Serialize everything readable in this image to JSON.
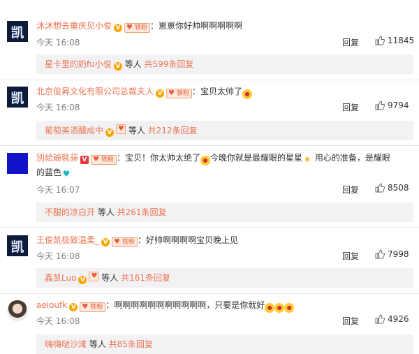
{
  "comments": [
    {
      "username": "沐沐想去重庆见小俊",
      "fan_badge": "铁粉",
      "text": "：崽崽你好帅啊啊啊啊啊",
      "time": "今天 16:08",
      "reply_label": "回复",
      "likes": "11845",
      "replies": {
        "users": "星卡里的奶fu小俊",
        "mid": " 等人 ",
        "count": "共599条回复"
      }
    },
    {
      "username": "北京俊昇文化有限公司总裁夫人",
      "fan_badge": "铁粉",
      "text": "：宝贝太帅了",
      "time": "今天 16:08",
      "reply_label": "回复",
      "likes": "9794",
      "replies": {
        "users": "葡萄美酒醺成中",
        "mid": " 等人 ",
        "count": "共212条回复"
      }
    },
    {
      "username": "別給爺裝蒜",
      "fan_badge": "铁粉",
      "text_a": "：宝贝！你太帅太绝了",
      "text_b": "今晚你就是最耀眼的星星",
      "text_c": " 用心的准备，是耀眼",
      "text_d": "的蓝色",
      "time": "今天 16:07",
      "reply_label": "回复",
      "likes": "8508",
      "replies": {
        "users": "不甜的凉白开",
        "mid": " 等人 ",
        "count": "共261条回复"
      }
    },
    {
      "username": "王俊凯极致温柔_",
      "fan_badge": "铁粉",
      "text": "：好帅啊啊啊啊宝贝晚上见",
      "time": "今天 16:08",
      "reply_label": "回复",
      "likes": "7998",
      "replies": {
        "users": "鑫凯Luo",
        "mid": " 等人 ",
        "count": "共161条回复"
      }
    },
    {
      "username": "aeioufk",
      "fan_badge": "铁粉",
      "text": "：啊啊啊啊啊啊啊啊啊啊啊，只要是你就好",
      "time": "今天 16:08",
      "reply_label": "回复",
      "likes": "4926",
      "replies": {
        "users": "嗨嗨哒沙滩",
        "mid": " 等人 ",
        "count": "共85条回复"
      }
    }
  ],
  "avatar_glyph": "凯",
  "colors": {
    "username": "#eb7350",
    "verified": "#f7a600",
    "reply_bg": "#f2f2f5"
  },
  "icons": [
    "thumb-up-icon",
    "verified-v-icon",
    "fan-badge-icon",
    "emoji-icon"
  ]
}
